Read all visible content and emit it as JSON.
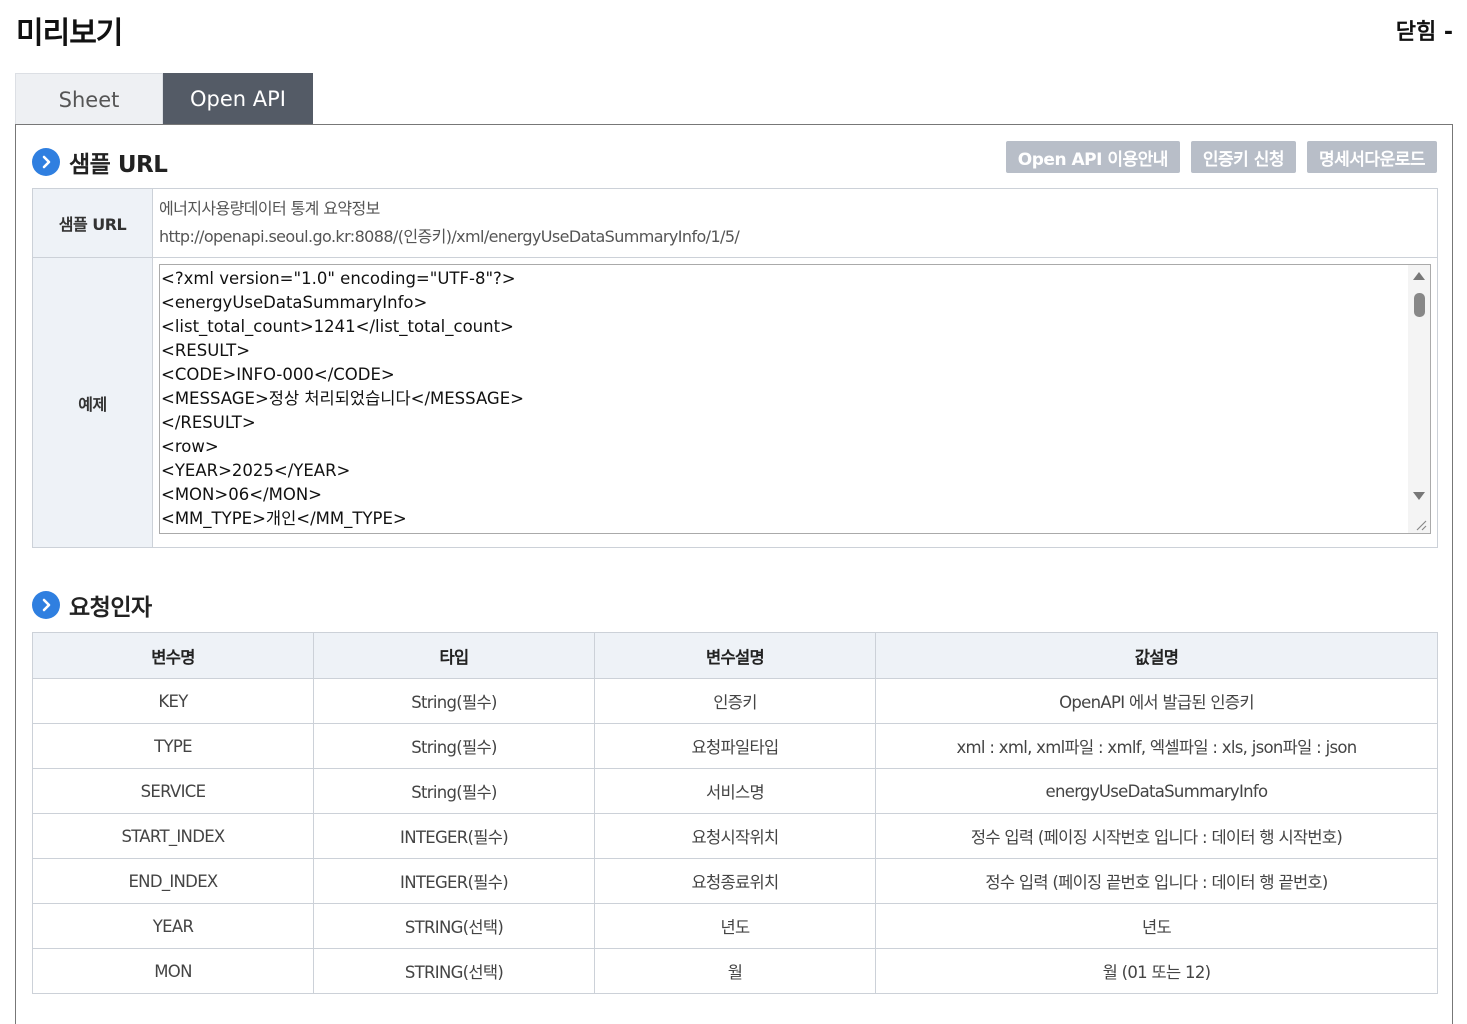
{
  "header": {
    "title": "미리보기",
    "close_label": "닫힘 -"
  },
  "tabs": [
    {
      "label": "Sheet",
      "active": false
    },
    {
      "label": "Open API",
      "active": true
    }
  ],
  "sample_section": {
    "title": "샘플 URL",
    "buttons": [
      "Open API 이용안내",
      "인증키 신청",
      "명세서다운로드"
    ],
    "url_label": "샘플 URL",
    "url_desc": "에너지사용량데이터 통계 요약정보",
    "url_value": "http://openapi.seoul.go.kr:8088/(인증키)/xml/energyUseDataSummaryInfo/1/5/",
    "example_label": "예제",
    "example_lines": [
      "<?xml version=\"1.0\" encoding=\"UTF-8\"?>",
      "<energyUseDataSummaryInfo>",
      "<list_total_count>1241</list_total_count>",
      "<RESULT>",
      "<CODE>INFO-000</CODE>",
      "<MESSAGE>정상 처리되었습니다</MESSAGE>",
      "</RESULT>",
      "<row>",
      "<YEAR>2025</YEAR>",
      "<MON>06</MON>",
      "<MM_TYPE>개인</MM_TYPE>"
    ]
  },
  "request_section": {
    "title": "요청인자",
    "columns": [
      "변수명",
      "타입",
      "변수설명",
      "값설명"
    ],
    "rows": [
      [
        "KEY",
        "String(필수)",
        "인증키",
        "OpenAPI 에서 발급된 인증키"
      ],
      [
        "TYPE",
        "String(필수)",
        "요청파일타입",
        "xml : xml, xml파일 : xmlf, 엑셀파일 : xls, json파일 : json"
      ],
      [
        "SERVICE",
        "String(필수)",
        "서비스명",
        "energyUseDataSummaryInfo"
      ],
      [
        "START_INDEX",
        "INTEGER(필수)",
        "요청시작위치",
        "정수 입력 (페이징 시작번호 입니다 : 데이터 행 시작번호)"
      ],
      [
        "END_INDEX",
        "INTEGER(필수)",
        "요청종료위치",
        "정수 입력 (페이징 끝번호 입니다 : 데이터 행 끝번호)"
      ],
      [
        "YEAR",
        "STRING(선택)",
        "년도",
        "년도"
      ],
      [
        "MON",
        "STRING(선택)",
        "월",
        "월 (01 또는 12)"
      ]
    ]
  },
  "colors": {
    "accent_blue": "#2f7fe0",
    "active_tab": "#545b66",
    "gray_button": "#b8bec8",
    "header_cell": "#eef2f7"
  },
  "icons": [
    "chevron-right-circle-icon",
    "scroll-up-arrow-icon",
    "scroll-down-arrow-icon",
    "resize-grip-icon"
  ]
}
